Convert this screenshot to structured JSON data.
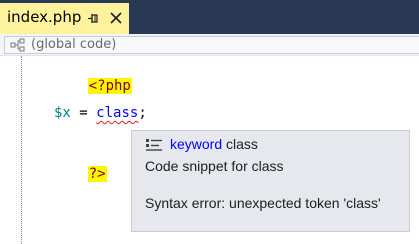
{
  "tab": {
    "title": "index.php",
    "pin_icon": "pin-icon",
    "close_icon": "close-icon"
  },
  "navigation": {
    "scope_icon": "scope-icon",
    "scope_label": "(global code)"
  },
  "editor": {
    "lines": [
      {
        "open_tag": "<?php"
      },
      {
        "variable": "$x",
        "operator": " = ",
        "keyword": "class",
        "terminator": ";"
      },
      {
        "close_tag": "?>"
      }
    ]
  },
  "tooltip": {
    "icon": "snippet-icon",
    "keyword_label": "keyword",
    "keyword_name": "class",
    "description": "Code snippet for class",
    "error": "Syntax error: unexpected token 'class'"
  },
  "colors": {
    "tab_strip": "#293955",
    "active_tab": "#fff29d",
    "php_tag_highlight": "#fff700",
    "keyword": "#0000ff",
    "variable": "#008080",
    "error_squiggle": "#e0201f",
    "tooltip_bg": "#e6e8ee"
  }
}
